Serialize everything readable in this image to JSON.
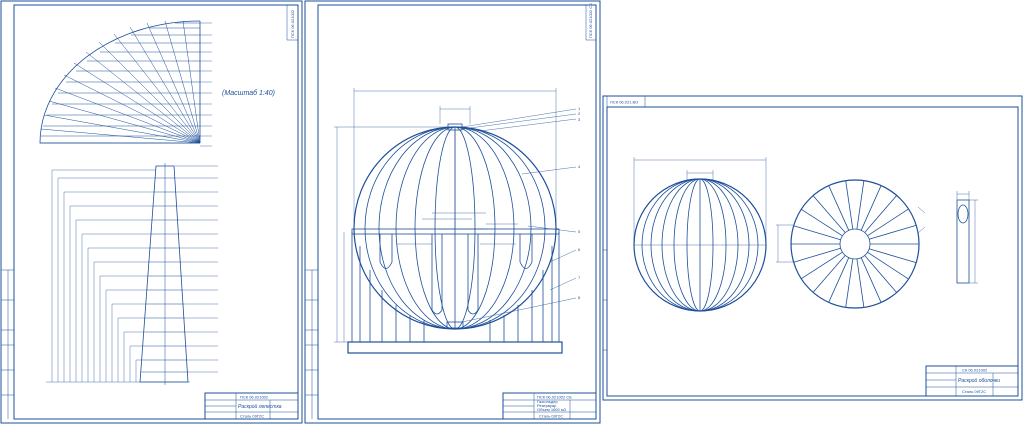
{
  "sheet1": {
    "scale_note": "(Масштаб 1:40)",
    "stamp_code": "ПСК 06.021002",
    "stamp_title": "Раскрой лепестка",
    "stamp_material": "Сталь 09Г2С",
    "side_code": "ПСК 06.021002"
  },
  "sheet2": {
    "stamp_code": "ПСК 06.021002 СБ",
    "stamp_line1": "Газгольдер",
    "stamp_line2": "Резервуар",
    "stamp_line3": "Объем 1600 м3",
    "stamp_material": "Сталь 09Г2С",
    "side_code": "ПСК 06.021002 СБ",
    "callout_numbers": [
      "1",
      "2",
      "3",
      "4",
      "5",
      "6",
      "7",
      "8"
    ]
  },
  "sheet3": {
    "stamp_code": "СК 06.021002",
    "stamp_title": "Раскрой оболочки",
    "stamp_material": "Сталь 09Г2С",
    "side_code": "ПСК 06.021 ВО"
  }
}
